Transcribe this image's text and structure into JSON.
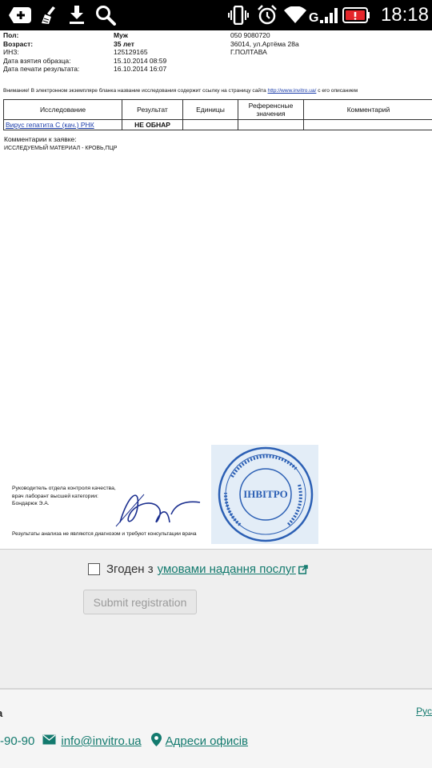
{
  "status_bar": {
    "time": "18:18",
    "icons": [
      "add-icon",
      "cleaner-icon",
      "download-icon",
      "search-icon",
      "vibrate-icon",
      "alarm-icon",
      "wifi-icon",
      "signal-icon",
      "battery-alert-icon"
    ]
  },
  "document": {
    "patient": {
      "sex_label": "Пол:",
      "sex_value": "Муж",
      "phone": "050 9080720",
      "age_label": "Возраст:",
      "age_value": "35 лет",
      "address_line1": "36014, ул.Артёма 28а",
      "inz_label": "ИНЗ:",
      "inz_value": "125129165",
      "city": "Г.ПОЛТАВА",
      "sample_date_label": "Дата взятия образца:",
      "sample_date_value": "15.10.2014 08:59",
      "print_date_label": "Дата печати результата:",
      "print_date_value": "16.10.2014 16:07"
    },
    "notice_text": "Внимание! В электронном экземпляре бланка название исследования содержит ссылку на страницу сайта",
    "notice_link": "http://www.invitro.ua/",
    "notice_tail": "с его описанием",
    "table": {
      "headers": [
        "Исследование",
        "Результат",
        "Единицы",
        "Референсные значения",
        "Комментарий"
      ],
      "rows": [
        {
          "test": "Вирус гепатита С (кач.) РНК",
          "result": "НЕ ОБНАР",
          "units": "",
          "reference": "",
          "comment": ""
        }
      ]
    },
    "comments_label": "Комментарии к заявке:",
    "material": "ИССЛЕДУЕМЫЙ МАТЕРИАЛ - КРОВЬ,ПЦР",
    "signer_line1": "Руководитель отдела контроля качества,",
    "signer_line2": "врач лаборант высшей категории:",
    "signer_name": "Бондарюк Э.А.",
    "disclaimer": "Результаты анализа не являются диагнозом и требуют консультации врача",
    "stamp_text": "ІНВІТРО"
  },
  "form": {
    "agree_text": "Згоден з",
    "agree_link": "умовами надання послуг",
    "submit_label": "Submit registration"
  },
  "footer": {
    "fragment": "а",
    "language": "Рус",
    "phone_fragment": "-90-90",
    "email": "info@invitro.ua",
    "offices": "Адреси офисів"
  },
  "colors": {
    "link_teal": "#137a6e",
    "doc_link_blue": "#1a3caa",
    "stamp_blue": "#2b5fb4"
  }
}
